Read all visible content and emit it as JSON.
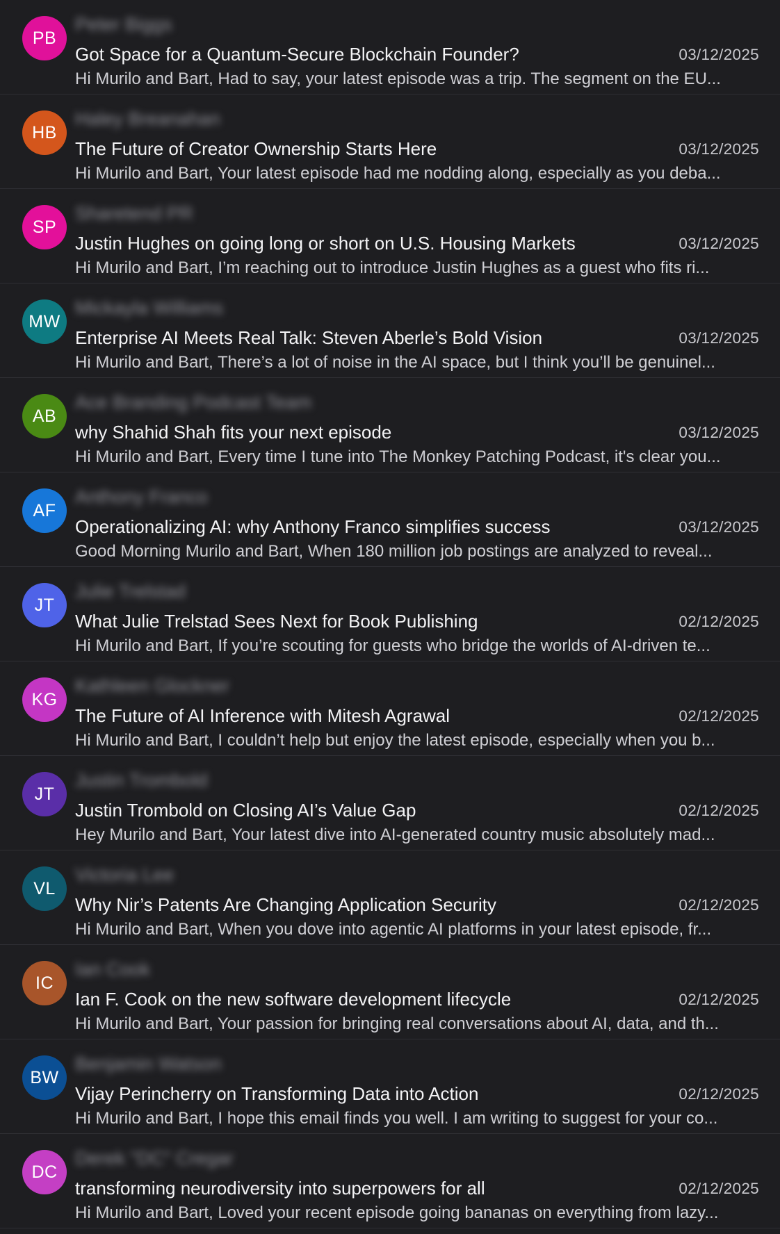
{
  "emails": [
    {
      "initials": "PB",
      "avatar_color": "#e0119a",
      "sender": "Peter Biggs",
      "subject": "Got Space for a Quantum-Secure Blockchain Founder?",
      "date": "03/12/2025",
      "preview": "Hi Murilo and Bart, Had to say, your latest episode was a trip. The segment on the EU..."
    },
    {
      "initials": "HB",
      "avatar_color": "#d4561c",
      "sender": "Haley Breanahan",
      "subject": "The Future of Creator Ownership Starts Here",
      "date": "03/12/2025",
      "preview": "Hi Murilo and Bart, Your latest episode had me nodding along, especially as you deba..."
    },
    {
      "initials": "SP",
      "avatar_color": "#e3109a",
      "sender": "Sharetend PR",
      "subject": "Justin Hughes on going long or short on U.S. Housing Markets",
      "date": "03/12/2025",
      "preview": "Hi Murilo and Bart, I’m reaching out to introduce Justin Hughes as a guest who fits ri..."
    },
    {
      "initials": "MW",
      "avatar_color": "#0e7b82",
      "sender": "Mickayla Williams",
      "subject": "Enterprise AI Meets Real Talk: Steven Aberle’s Bold Vision",
      "date": "03/12/2025",
      "preview": "Hi Murilo and Bart, There’s a lot of noise in the AI space, but I think you’ll be genuinel..."
    },
    {
      "initials": "AB",
      "avatar_color": "#4a8a14",
      "sender": "Ace Branding Podcast Team",
      "subject": "why Shahid Shah fits your next episode",
      "date": "03/12/2025",
      "preview": "Hi Murilo and Bart, Every time I tune into The Monkey Patching Podcast, it's clear you..."
    },
    {
      "initials": "AF",
      "avatar_color": "#1777d9",
      "sender": "Anthony Franco",
      "subject": "Operationalizing AI: why Anthony Franco simplifies success",
      "date": "03/12/2025",
      "preview": "Good Morning Murilo and Bart, When 180 million job postings are analyzed to reveal..."
    },
    {
      "initials": "JT",
      "avatar_color": "#4f63e8",
      "sender": "Julie Trelstad",
      "subject": "What Julie Trelstad Sees Next for Book Publishing",
      "date": "02/12/2025",
      "preview": "Hi Murilo and Bart, If you’re scouting for guests who bridge the worlds of AI-driven te..."
    },
    {
      "initials": "KG",
      "avatar_color": "#c436c4",
      "sender": "Kathleen Glockner",
      "subject": "The Future of AI Inference with Mitesh Agrawal",
      "date": "02/12/2025",
      "preview": "Hi Murilo and Bart, I couldn’t help but enjoy the latest episode, especially when you b..."
    },
    {
      "initials": "JT",
      "avatar_color": "#5a2ea8",
      "sender": "Justin Trombold",
      "subject": "Justin Trombold on Closing AI’s Value Gap",
      "date": "02/12/2025",
      "preview": "Hey Murilo and Bart, Your latest dive into AI-generated country music absolutely mad..."
    },
    {
      "initials": "VL",
      "avatar_color": "#0f5a6e",
      "sender": "Victoria Lee",
      "subject": "Why Nir’s Patents Are Changing Application Security",
      "date": "02/12/2025",
      "preview": "Hi Murilo and Bart, When you dove into agentic AI platforms in your latest episode, fr..."
    },
    {
      "initials": "IC",
      "avatar_color": "#a8552a",
      "sender": "Ian Cook",
      "subject": "Ian F. Cook on the new software development lifecycle",
      "date": "02/12/2025",
      "preview": "Hi Murilo and Bart, Your passion for bringing real conversations about AI, data, and th..."
    },
    {
      "initials": "BW",
      "avatar_color": "#0b4f94",
      "sender": "Benjamin Watson",
      "subject": "Vijay Perincherry on Transforming Data into Action",
      "date": "02/12/2025",
      "preview": "Hi Murilo and Bart, I hope this email finds you well. I am writing to suggest for your co..."
    },
    {
      "initials": "DC",
      "avatar_color": "#c43fc4",
      "sender": "Derek \"DC\" Cregar",
      "subject": "transforming neurodiversity into superpowers for all",
      "date": "02/12/2025",
      "preview": "Hi Murilo and Bart, Loved your recent episode going bananas on everything from lazy..."
    }
  ]
}
